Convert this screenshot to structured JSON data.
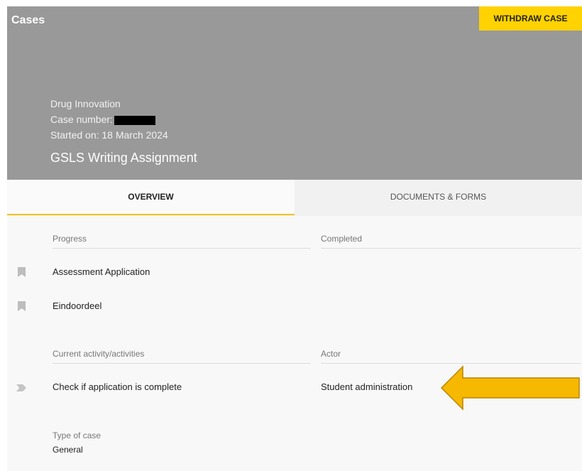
{
  "header": {
    "title": "Cases",
    "withdraw_label": "WITHDRAW CASE",
    "program": "Drug Innovation",
    "case_number_label": "Case number:",
    "started_on": "Started on: 18 March 2024",
    "case_title": "GSLS Writing Assignment"
  },
  "tabs": [
    {
      "label": "OVERVIEW",
      "active": true
    },
    {
      "label": "DOCUMENTS & FORMS",
      "active": false
    }
  ],
  "progress_section": {
    "col1": "Progress",
    "col2": "Completed",
    "items": [
      "Assessment Application",
      "Eindoordeel"
    ]
  },
  "activity_section": {
    "col1": "Current activity/activities",
    "col2": "Actor",
    "items": [
      {
        "activity": "Check if application is complete",
        "actor": "Student administration"
      }
    ]
  },
  "type_section": {
    "label": "Type of case",
    "value": "General"
  },
  "colors": {
    "header_bg": "#999999",
    "accent": "#ffd200",
    "arrow_fill": "#f6b800"
  },
  "annotation": {
    "icon": "left-arrow-icon"
  }
}
